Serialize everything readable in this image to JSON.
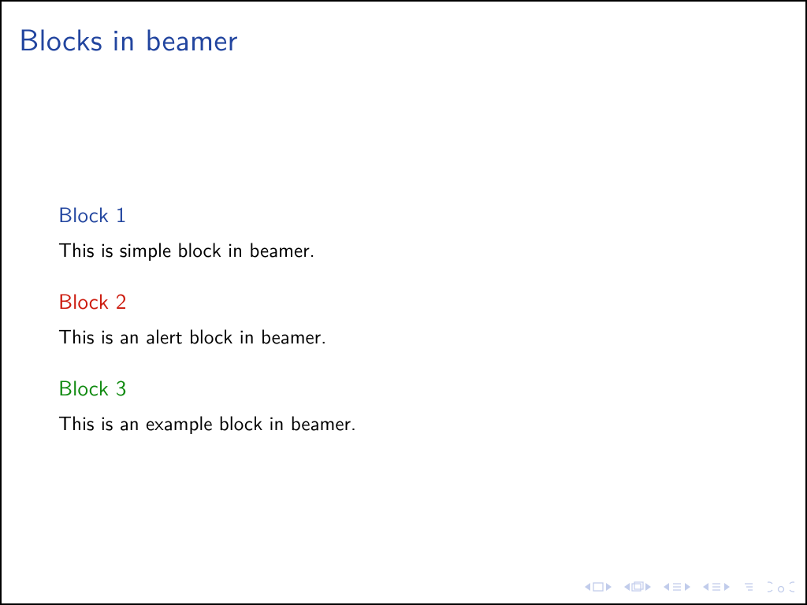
{
  "title": "Blocks in beamer",
  "blocks": [
    {
      "title": "Block 1",
      "body": "This is simple block in beamer.",
      "color": "structure"
    },
    {
      "title": "Block 2",
      "body": "This is an alert block in beamer.",
      "color": "alert"
    },
    {
      "title": "Block 3",
      "body": "This is an example block in beamer.",
      "color": "example"
    }
  ],
  "nav": {
    "icons": [
      "frame-nav",
      "slide-nav",
      "subsection-back",
      "subsection-fwd",
      "goto",
      "undo-redo"
    ]
  }
}
